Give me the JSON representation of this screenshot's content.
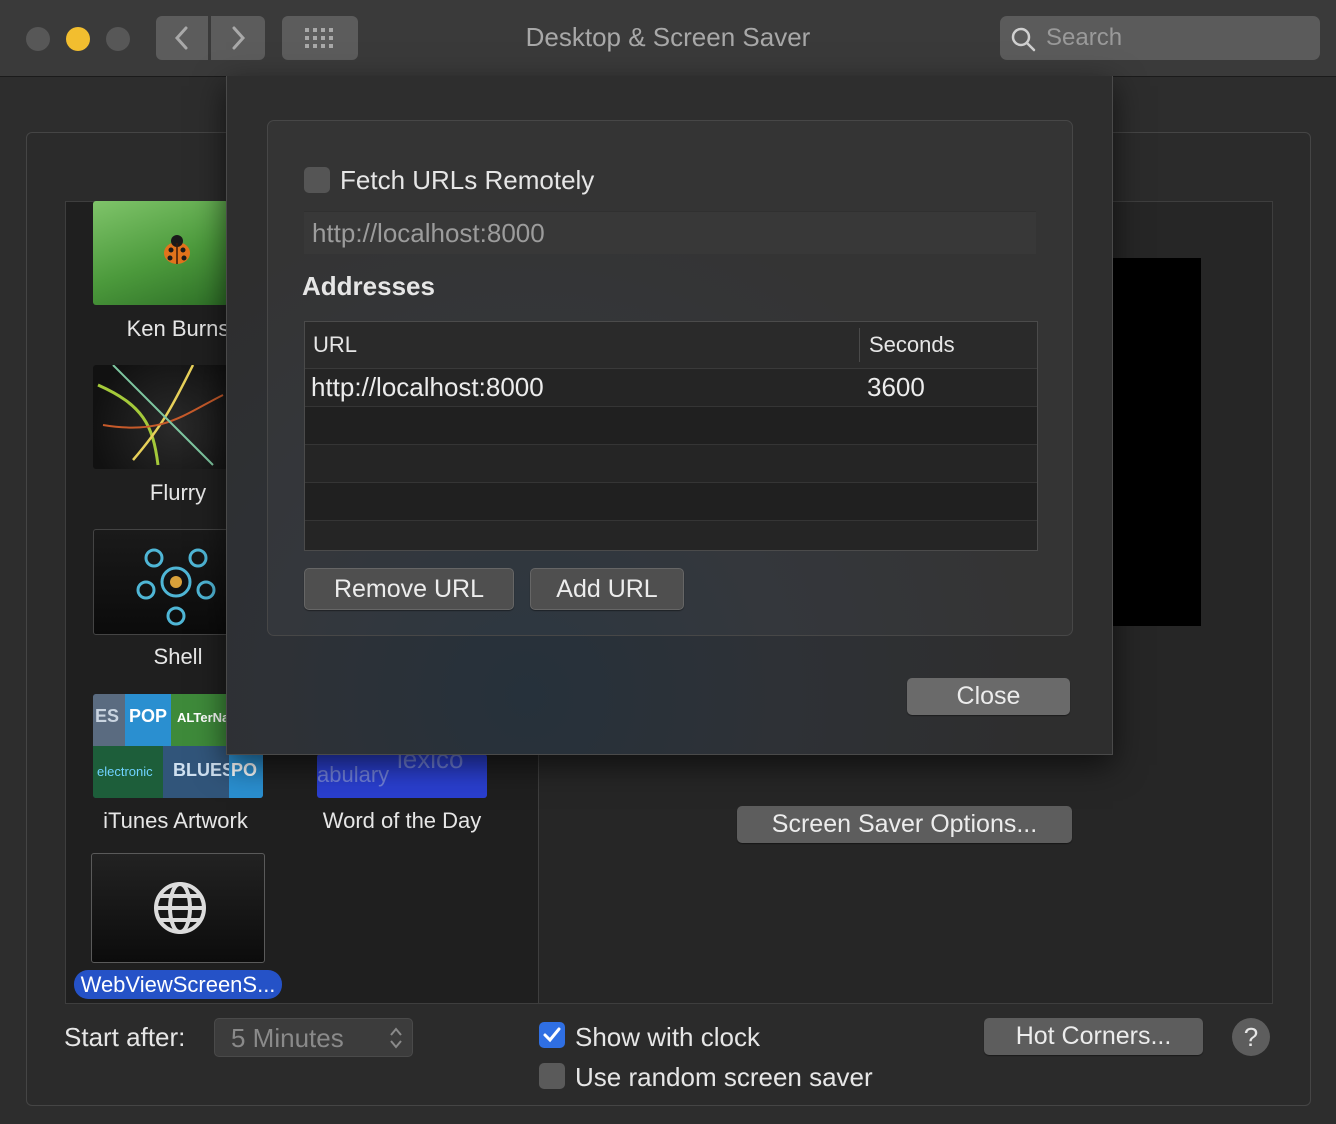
{
  "window": {
    "title": "Desktop & Screen Saver"
  },
  "search": {
    "placeholder": "Search"
  },
  "savers": [
    {
      "label": "Ken Burns"
    },
    {
      "label": "Flurry"
    },
    {
      "label": "Shell"
    },
    {
      "label": "iTunes Artwork"
    },
    {
      "label": "Word of the Day"
    },
    {
      "label": "WebViewScreenS..."
    }
  ],
  "itunes_tiles": [
    "ES",
    "POP",
    "ALTerNaTive",
    "electronic",
    "BLUES",
    "PO"
  ],
  "word_tile_text": [
    "lexico",
    "abulary"
  ],
  "preview": {
    "options_button": "Screen Saver Options..."
  },
  "bottom": {
    "start_after_label": "Start after:",
    "start_after_value": "5 Minutes",
    "show_clock_label": "Show with clock",
    "show_clock_checked": true,
    "random_label": "Use random screen saver",
    "random_checked": false,
    "hot_corners_button": "Hot Corners...",
    "help_button": "?"
  },
  "sheet": {
    "fetch_label": "Fetch URLs Remotely",
    "fetch_checked": false,
    "fetch_url": "http://localhost:8000",
    "addresses_heading": "Addresses",
    "table": {
      "columns": [
        "URL",
        "Seconds"
      ],
      "rows": [
        {
          "url": "http://localhost:8000",
          "seconds": "3600"
        }
      ]
    },
    "remove_button": "Remove URL",
    "add_button": "Add URL",
    "close_button": "Close"
  },
  "colors": {
    "accent": "#2f6fe3",
    "selection": "#2552c7",
    "minimize": "#f2be2f",
    "inactive_light": "#575757"
  }
}
